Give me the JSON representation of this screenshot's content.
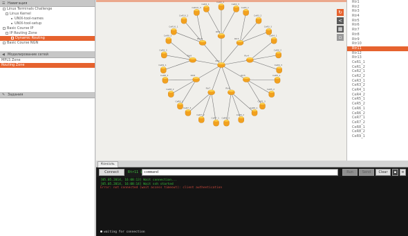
{
  "colors": {
    "accent": "#e6622e",
    "router_fill": "#f2a11f",
    "router_top": "#fbd04a",
    "terminal_bg": "#141414"
  },
  "left_panel": {
    "nav_header": "Навигация",
    "tree": [
      {
        "label": "Linux Terminals Challenge",
        "indent": 1,
        "marker": "box",
        "selected": false
      },
      {
        "label": "Linux Kernel",
        "indent": 2,
        "marker": "box",
        "selected": false
      },
      {
        "label": "UNIX-tool-names",
        "indent": 4,
        "marker": "dot",
        "selected": false
      },
      {
        "label": "UNIX-tool-setup",
        "indent": 4,
        "marker": "dot",
        "selected": false
      },
      {
        "label": "Basic Course IP",
        "indent": 1,
        "marker": "box",
        "selected": false
      },
      {
        "label": "IP Routing Zone",
        "indent": 2,
        "marker": "box",
        "selected": false
      },
      {
        "label": "Dynamic Routing",
        "indent": 4,
        "marker": "box",
        "selected": true
      },
      {
        "label": "Basic Course NGN",
        "indent": 1,
        "marker": "box",
        "selected": false
      }
    ],
    "modules_header": "Моделирование сетей",
    "modules": [
      {
        "label": "MPLS Zone",
        "selected": false
      },
      {
        "label": "Routing Zone",
        "selected": true
      }
    ],
    "tasks_header": "Задания"
  },
  "toolbar": {
    "icons": [
      "refresh-icon",
      "share-icon",
      "grid-icon",
      "map-icon"
    ]
  },
  "routers": {
    "items": [
      "Rtr1",
      "Rtr2",
      "Rtr3",
      "Rtr4",
      "Rtr5",
      "Rtr6",
      "Rtr7",
      "Rtr8",
      "Rtr9",
      "Rtr10",
      "Rtr11",
      "Rtr12",
      "Rtr13",
      "CeR1_1",
      "CeR1_2",
      "CeR2_1",
      "CeR2_2",
      "CeR3_1",
      "CeR3_2",
      "CeR4_1",
      "CeR4_2",
      "CeR5_1",
      "CeR5_2",
      "CeR6_1",
      "CeR6_2",
      "CeR7_1",
      "CeR7_2",
      "CeR8_1",
      "CeR8_2",
      "CeR9_1"
    ],
    "selected_index": 10
  },
  "graph": {
    "center": "Rtr1",
    "hubs": [
      {
        "name": "Rtr2",
        "leaves": [
          "CeR2_1",
          "CeR2_2",
          "CeR2_3"
        ]
      },
      {
        "name": "Rtr3",
        "leaves": [
          "CeR3_1",
          "CeR3_2",
          "CeR3_3"
        ]
      },
      {
        "name": "Rtr4",
        "leaves": [
          "CeR4_1",
          "CeR4_2",
          "CeR4_3"
        ]
      },
      {
        "name": "Rtr5",
        "leaves": [
          "CeR5_1",
          "CeR5_2",
          "CeR5_3"
        ]
      },
      {
        "name": "Rtr6",
        "leaves": [
          "CeR6_1",
          "CeR6_2",
          "CeR6_3"
        ]
      },
      {
        "name": "Rtr7",
        "leaves": [
          "CeR7_1",
          "CeR7_2",
          "CeR7_3"
        ]
      },
      {
        "name": "Rtr8",
        "leaves": [
          "CeR8_1",
          "CeR8_2",
          "CeR8_3"
        ]
      },
      {
        "name": "Rtr9",
        "leaves": [
          "CeR9_1",
          "CeR9_2",
          "CeR9_3"
        ]
      },
      {
        "name": "Rtr10",
        "leaves": [
          "CeR10_1",
          "CeR10_2",
          "CeR10_3"
        ]
      }
    ]
  },
  "terminal": {
    "tab": "Консоль",
    "connect_label": "Connect",
    "prompt": "Rtr11 $",
    "command_value": "command",
    "buttons": [
      "Run",
      "Send",
      "Clear"
    ],
    "lines": [
      {
        "text": "[05.05.2014, 16:08:13] Wait connection...",
        "color": "green"
      },
      {
        "text": "[05.05.2014, 16:08:14] Wait ssh started",
        "color": "green"
      },
      {
        "text": "  Error: not connected (wait access timeout): client authentication",
        "color": "red"
      }
    ],
    "status": "waiting for connection"
  }
}
